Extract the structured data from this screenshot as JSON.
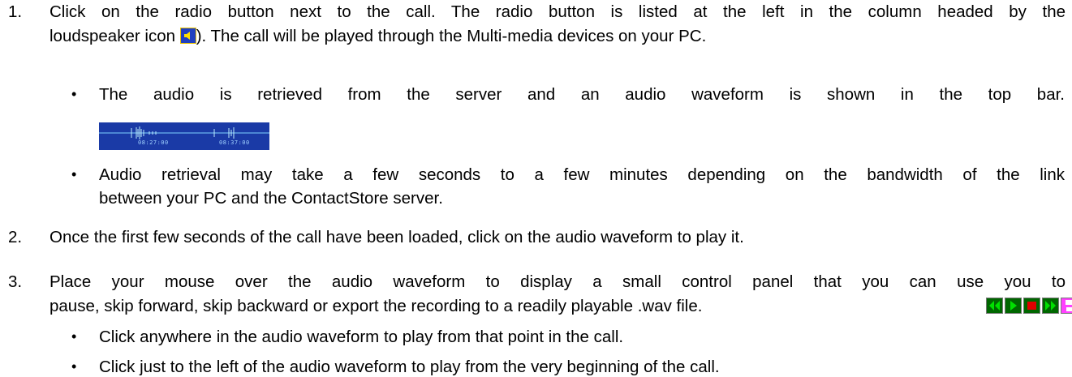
{
  "steps": [
    {
      "number": "1.",
      "line1": "Click on the radio button next to the call. The radio button is listed at the left in the column headed by the",
      "line2_before_icon": "loudspeaker icon ",
      "line2_after_icon": "). The call will be played through the Multi-media devices on your PC."
    },
    {
      "number": "2.",
      "line1": "Once the first few seconds of the call have been loaded, click on the audio waveform to play it."
    },
    {
      "number": "3.",
      "line1": "Place your mouse over the audio waveform to display a small control panel that you can use you to",
      "line2": "pause, skip forward, skip backward or export the recording to a readily playable .wav file."
    }
  ],
  "step1_bullets": [
    {
      "bullet": "•",
      "line1": "The audio is retrieved from the server and an audio waveform is shown in the top bar."
    },
    {
      "bullet": "•",
      "line1": "Audio retrieval may take a few seconds to a few minutes depending on the bandwidth of the link",
      "line2": "between your PC and the ContactStore server."
    }
  ],
  "step3_bullets": [
    {
      "bullet": "•",
      "text": "Click anywhere in the audio waveform to play from that point in the call."
    },
    {
      "bullet": "•",
      "text": "Click just to the left of the audio waveform to play from the very beginning of the call."
    }
  ],
  "waveform": {
    "time_left": "08:27:00",
    "time_right": "08:37:00",
    "background": "#1a3aa6"
  },
  "icons": {
    "speaker": "loudspeaker-icon",
    "controls": [
      "skip-backward-icon",
      "play-icon",
      "stop-icon",
      "skip-forward-icon",
      "save-icon"
    ]
  },
  "colors": {
    "control_green": "#00c000",
    "control_red": "#e00000",
    "control_magenta": "#ff40ff",
    "control_bg": "#006600"
  }
}
